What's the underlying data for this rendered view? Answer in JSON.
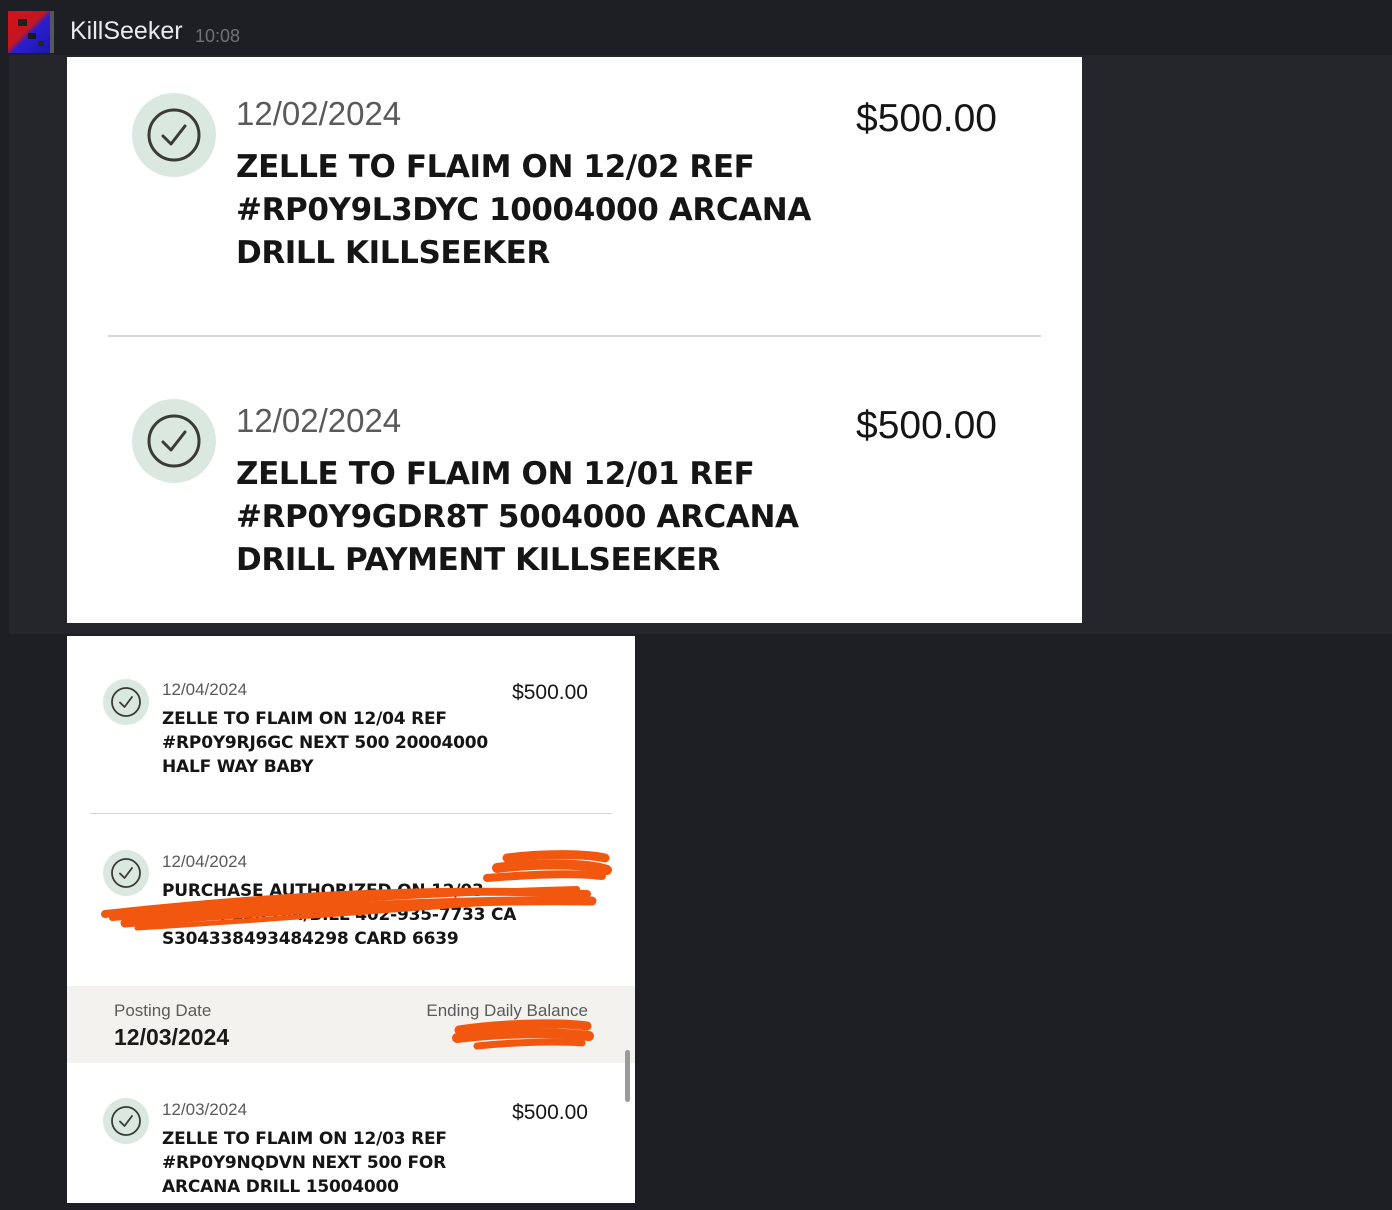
{
  "message": {
    "username": "KillSeeker",
    "timestamp": "10:08"
  },
  "attachment_1": {
    "transactions": [
      {
        "date": "12/02/2024",
        "amount": "$500.00",
        "description_lines": [
          "ZELLE TO FLAIM ON 12/02 REF",
          "#RP0Y9L3DYC 10004000 ARCANA",
          "DRILL KILLSEEKER"
        ]
      },
      {
        "date": "12/02/2024",
        "amount": "$500.00",
        "description_lines": [
          "ZELLE TO FLAIM ON 12/01 REF",
          "#RP0Y9GDR8T 5004000 ARCANA",
          "DRILL PAYMENT KILLSEEKER"
        ]
      }
    ]
  },
  "attachment_2": {
    "transactions": [
      {
        "date": "12/04/2024",
        "amount": "$500.00",
        "description_lines": [
          "ZELLE TO FLAIM ON 12/04 REF",
          "#RP0Y9RJ6GC NEXT 500 20004000",
          "HALF WAY BABY"
        ]
      },
      {
        "date": "12/04/2024",
        "amount": "",
        "description_lines": [
          "PURCHASE AUTHORIZED ON 12/03",
          "FP*APPLE.COM/BILL 402-935-7733 CA",
          "S304338493484298 CARD 6639"
        ]
      },
      {
        "date": "12/03/2024",
        "amount": "$500.00",
        "description_lines": [
          "ZELLE TO FLAIM ON 12/03 REF",
          "#RP0Y9NQDVN NEXT 500 FOR",
          "ARCANA DRILL 15004000"
        ]
      }
    ],
    "posting": {
      "label": "Posting Date",
      "date": "12/03/2024",
      "balance_label": "Ending Daily Balance"
    }
  },
  "colors": {
    "check_bg": "#dbe8df",
    "check_stroke": "#3a3a3a",
    "redaction": "#f2570f",
    "background": "#1e1f25"
  },
  "icons": [
    "avatar",
    "check-circle-icon",
    "scrollbar"
  ]
}
